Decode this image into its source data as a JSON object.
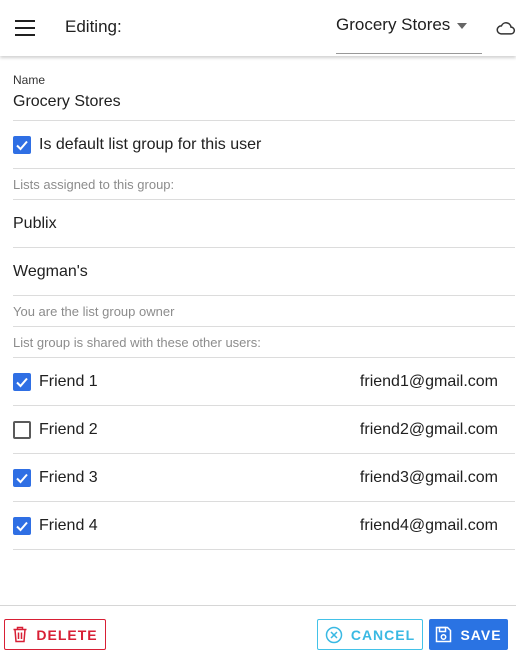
{
  "header": {
    "editing_label": "Editing:",
    "group_selected": "Grocery Stores"
  },
  "form": {
    "name_label": "Name",
    "name_value": "Grocery Stores",
    "default_checkbox_label": "Is default list group for this user",
    "default_checked": true,
    "lists_caption": "Lists assigned to this group:",
    "lists": [
      "Publix",
      "Wegman's"
    ],
    "owner_caption": "You are the list group owner",
    "shared_caption": "List group is shared with these other users:",
    "friends": [
      {
        "name": "Friend 1",
        "email": "friend1@gmail.com",
        "checked": true
      },
      {
        "name": "Friend 2",
        "email": "friend2@gmail.com",
        "checked": false
      },
      {
        "name": "Friend 3",
        "email": "friend3@gmail.com",
        "checked": true
      },
      {
        "name": "Friend 4",
        "email": "friend4@gmail.com",
        "checked": true
      }
    ]
  },
  "footer": {
    "delete_label": "DELETE",
    "cancel_label": "CANCEL",
    "save_label": "SAVE"
  },
  "colors": {
    "accent_blue": "#2f6fe4",
    "delete_red": "#d81f35",
    "cancel_cyan": "#43c2e8",
    "save_blue": "#2a73e3"
  },
  "icons": [
    "menu-icon",
    "chevron-down-icon",
    "cloud-icon",
    "checkbox-icon",
    "trash-icon",
    "cancel-circle-icon",
    "save-disk-icon"
  ]
}
